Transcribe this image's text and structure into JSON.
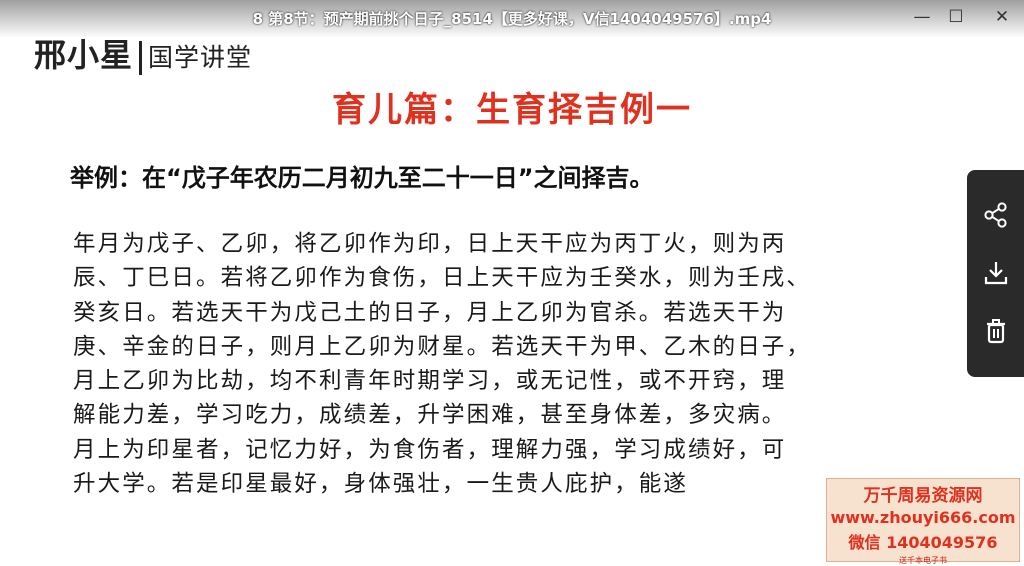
{
  "window": {
    "title": "8 第8节：预产期前挑个日子_8514【更多好课，V信1404049576】.mp4",
    "minimize_label": "—",
    "maximize_label": "☐",
    "close_label": "✕"
  },
  "logo": {
    "name": "邢小星",
    "subtitle": "国学讲堂"
  },
  "slide": {
    "heading": "育儿篇：生育择吉例一",
    "example": "举例：在“戊子年农历二月初九至二十一日”之间择吉。",
    "lines": [
      "年月为戊子、乙卯，将乙卯作为印，日上天干应为丙丁火，则为丙",
      "辰、丁巳日。若将乙卯作为食伤，日上天干应为壬癸水，则为壬戌、",
      "癸亥日。若选天干为戊己土的日子，月上乙卯为官杀。若选天干为",
      "庚、辛金的日子，则月上乙卯为财星。若选天干为甲、乙木的日子，",
      "月上乙卯为比劫，均不利青年时期学习，或无记性，或不开窍，理",
      "解能力差，学习吃力，成绩差，升学困难，甚至身体差，多灾病。",
      "月上为印星者，记忆力好，为食伤者，理解力强，学习成绩好，可",
      "升大学。若是印星最好，身体强壮，一生贵人庇护，能遂"
    ]
  },
  "side_panel": {
    "icons": [
      "share-icon",
      "download-icon",
      "trash-icon"
    ]
  },
  "watermark": {
    "line1": "万千周易资源网",
    "line2": "www.zhouyi666.com",
    "line3": "微信 1404049576",
    "line4": "送千本电子书"
  }
}
